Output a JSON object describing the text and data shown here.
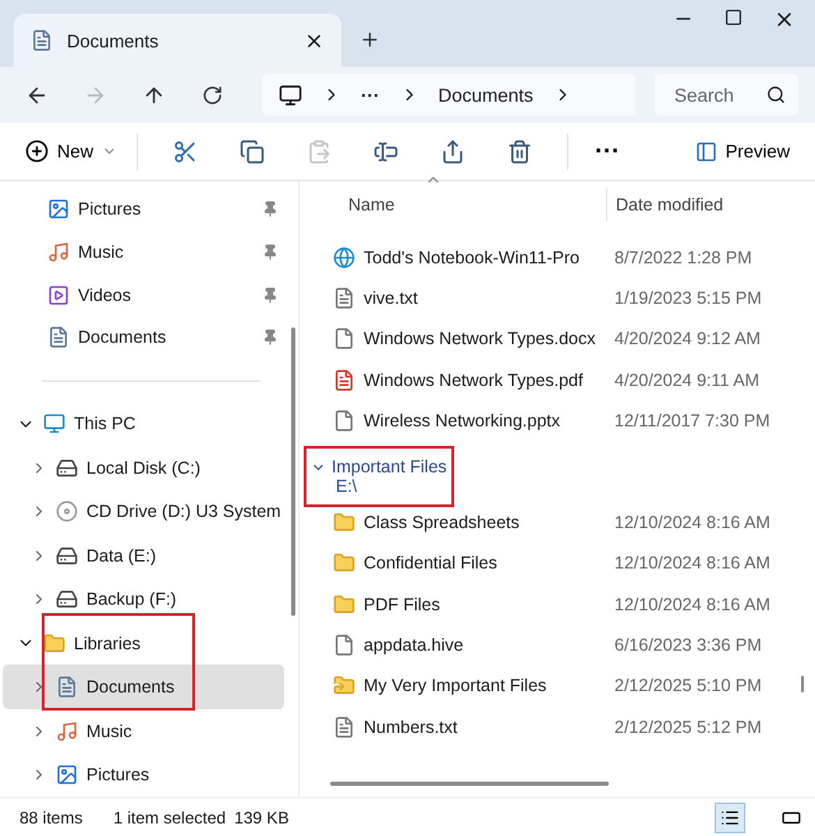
{
  "window": {
    "tab_title": "Documents"
  },
  "address": {
    "crumbs": [
      {
        "kind": "overflow",
        "label": "···"
      },
      {
        "kind": "folder",
        "label": "Documents"
      }
    ],
    "search_placeholder": "Search"
  },
  "toolbar": {
    "new_label": "New",
    "actions": [
      {
        "kind": "cut",
        "disabled": false
      },
      {
        "kind": "copy",
        "disabled": false
      },
      {
        "kind": "paste",
        "disabled": true
      },
      {
        "kind": "rename",
        "disabled": false
      },
      {
        "kind": "share",
        "disabled": false
      },
      {
        "kind": "delete",
        "disabled": false
      }
    ],
    "more_label": "···",
    "preview_label": "Preview"
  },
  "sidebar": {
    "pinned": [
      {
        "label": "Pictures",
        "kind": "pictures",
        "pinned": true
      },
      {
        "label": "Music",
        "kind": "music",
        "pinned": true
      },
      {
        "label": "Videos",
        "kind": "videos",
        "pinned": true
      },
      {
        "label": "Documents",
        "kind": "documents",
        "pinned": true
      }
    ],
    "tree": [
      {
        "label": "This PC",
        "kind": "pc",
        "expanded": true,
        "selected": false,
        "highlighted": false,
        "children": [
          {
            "label": "Local Disk (C:)",
            "kind": "windisk",
            "expanded": false,
            "selected": false
          },
          {
            "label": "CD Drive (D:) U3 System",
            "kind": "cd",
            "expanded": false,
            "selected": false
          },
          {
            "label": "Data (E:)",
            "kind": "disk",
            "expanded": false,
            "selected": false
          },
          {
            "label": "Backup (F:)",
            "kind": "disk",
            "expanded": false,
            "selected": false
          }
        ]
      },
      {
        "label": "Libraries",
        "kind": "folder",
        "expanded": true,
        "selected": false,
        "highlighted": true,
        "children": [
          {
            "label": "Documents",
            "kind": "documents",
            "expanded": false,
            "selected": true
          },
          {
            "label": "Music",
            "kind": "music",
            "expanded": false,
            "selected": false
          },
          {
            "label": "Pictures",
            "kind": "pictures",
            "expanded": false,
            "selected": false
          }
        ]
      }
    ]
  },
  "file_list": {
    "columns": [
      {
        "label": "Name",
        "sorted": true
      },
      {
        "label": "Date modified",
        "sorted": false
      }
    ],
    "rows": [
      {
        "name": "Todd's Notebook-Win11-Pro",
        "date": "8/7/2022 1:28 PM",
        "kind": "edge"
      },
      {
        "name": "vive.txt",
        "date": "1/19/2023 5:15 PM",
        "kind": "text"
      },
      {
        "name": "Windows Network Types.docx",
        "date": "4/20/2024 9:12 AM",
        "kind": "file"
      },
      {
        "name": "Windows Network Types.pdf",
        "date": "4/20/2024 9:11 AM",
        "kind": "pdf"
      },
      {
        "name": "Wireless Networking.pptx",
        "date": "12/11/2017 7:30 PM",
        "kind": "file"
      }
    ],
    "groups": [
      {
        "title": "Important Files",
        "path": "E:\\",
        "expanded": true,
        "highlighted": true,
        "rows": [
          {
            "name": "Class Spreadsheets",
            "date": "12/10/2024 8:16 AM",
            "kind": "folder"
          },
          {
            "name": "Confidential Files",
            "date": "12/10/2024 8:16 AM",
            "kind": "folder"
          },
          {
            "name": "PDF Files",
            "date": "12/10/2024 8:16 AM",
            "kind": "folder"
          },
          {
            "name": "appdata.hive",
            "date": "6/16/2023 3:36 PM",
            "kind": "file"
          },
          {
            "name": "My Very Important Files",
            "date": "2/12/2025 5:10 PM",
            "kind": "shortcut"
          },
          {
            "name": "Numbers.txt",
            "date": "2/12/2025 5:12 PM",
            "kind": "text"
          }
        ]
      }
    ]
  },
  "status_bar": {
    "item_count": "88 items",
    "selection": "1 item selected",
    "size": "139 KB",
    "views": [
      {
        "kind": "details",
        "selected": true
      },
      {
        "kind": "tiles",
        "selected": false
      }
    ]
  }
}
